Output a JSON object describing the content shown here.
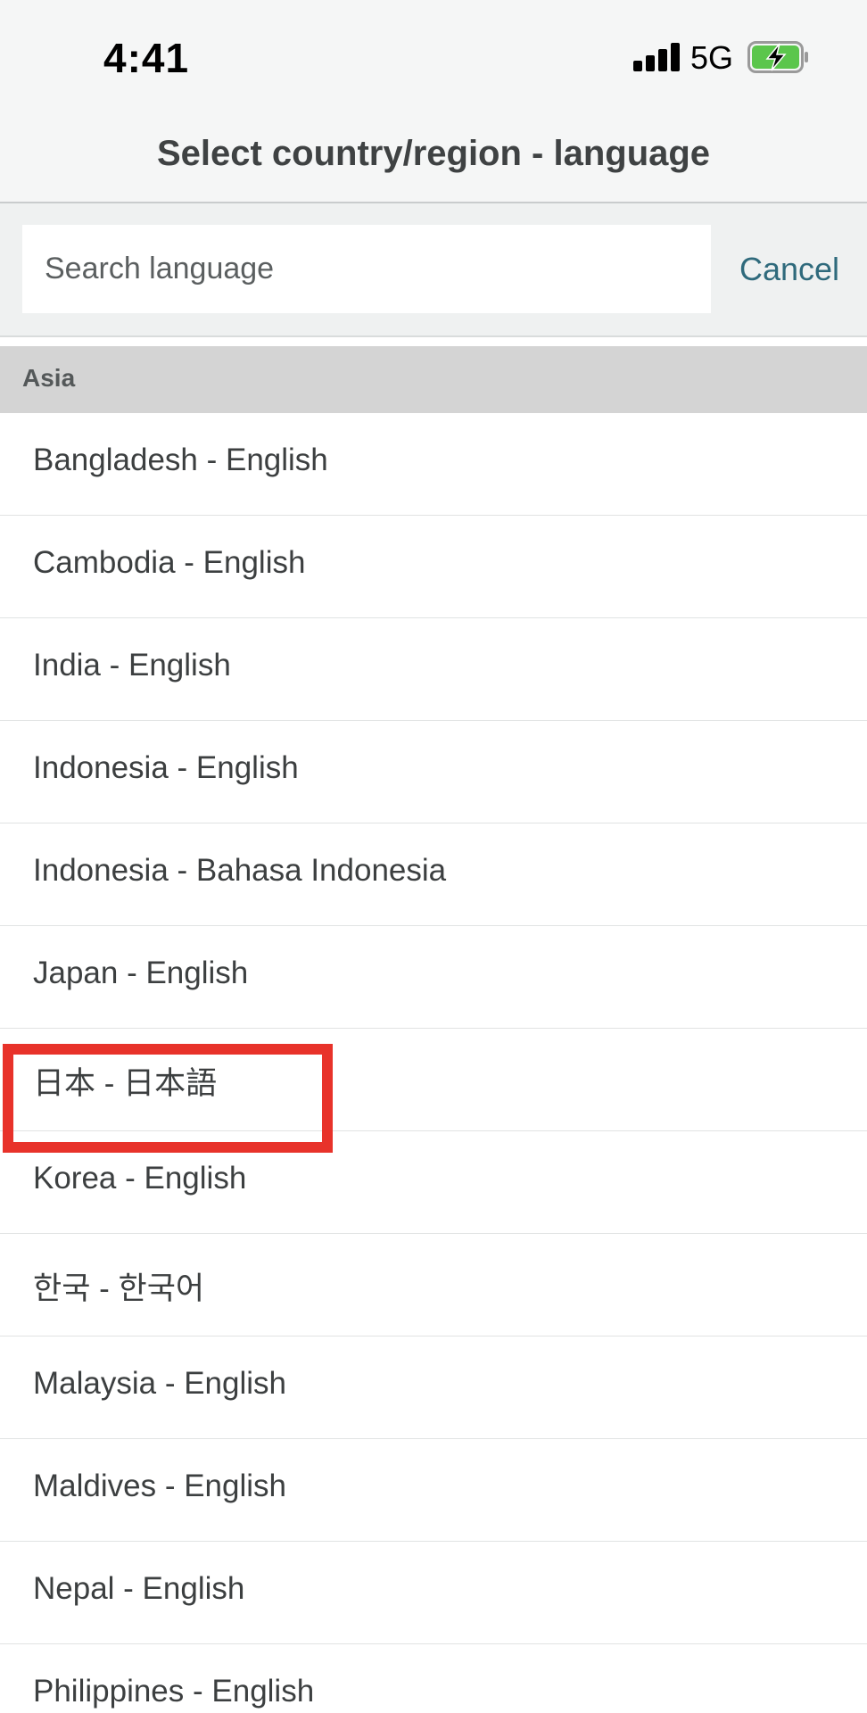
{
  "status_bar": {
    "time": "4:41",
    "network": "5G",
    "signal_icon": "cellular-signal-icon",
    "battery_icon": "battery-charging-icon",
    "battery_color": "#5bc64c"
  },
  "header": {
    "title": "Select country/region - language"
  },
  "search": {
    "placeholder": "Search language",
    "value": "",
    "cancel_label": "Cancel"
  },
  "section": {
    "title": "Asia"
  },
  "items": [
    {
      "label": "Bangladesh - English"
    },
    {
      "label": "Cambodia - English"
    },
    {
      "label": "India - English"
    },
    {
      "label": "Indonesia - English"
    },
    {
      "label": "Indonesia - Bahasa Indonesia"
    },
    {
      "label": "Japan - English"
    },
    {
      "label": "日本 - 日本語"
    },
    {
      "label": "Korea - English"
    },
    {
      "label": "한국 - 한국어"
    },
    {
      "label": "Malaysia - English"
    },
    {
      "label": "Maldives - English"
    },
    {
      "label": "Nepal - English"
    },
    {
      "label": "Philippines - English"
    }
  ],
  "highlight": {
    "color": "#e8322a",
    "target_item": "日本 - 日本語"
  },
  "colors": {
    "accent": "#2f6a7c",
    "header_bg": "#f5f6f6",
    "section_bg": "#d4d4d4"
  }
}
